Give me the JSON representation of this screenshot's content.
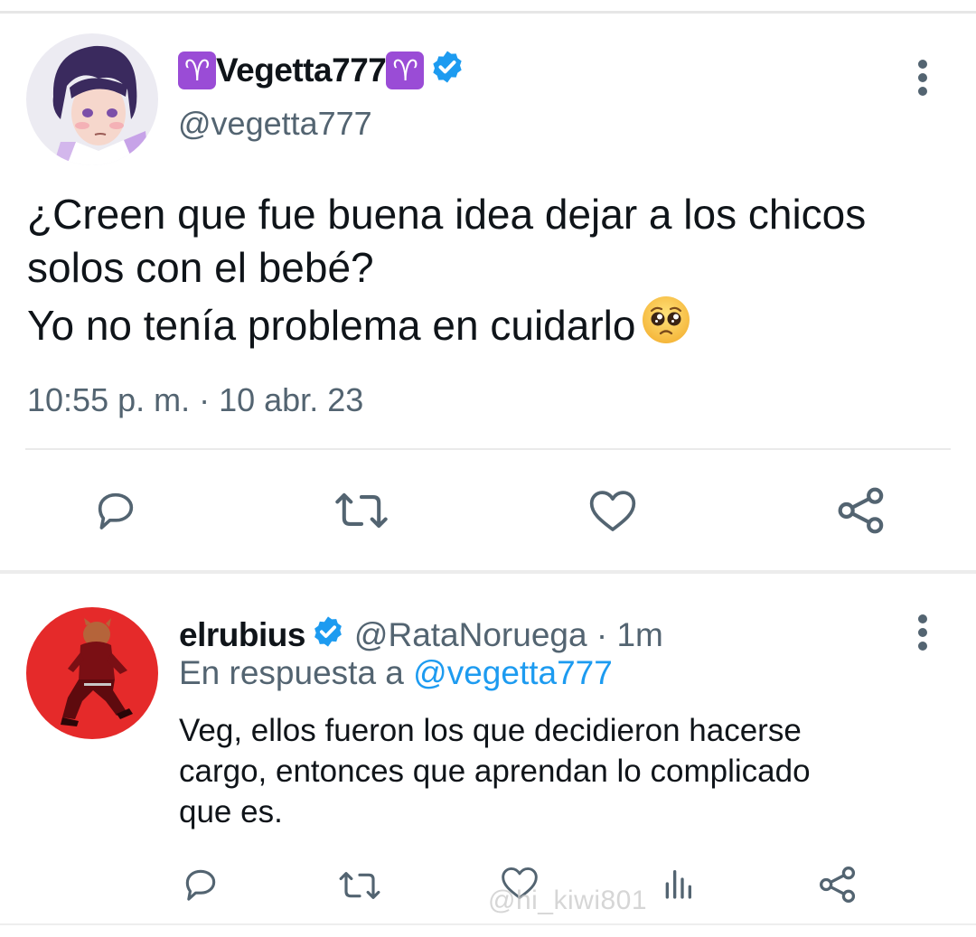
{
  "tweet": {
    "display_name_prefix_emoji": "♈",
    "display_name": "Vegetta777",
    "display_name_suffix_emoji": "♈",
    "handle": "@vegetta777",
    "text_lines": [
      "¿Creen que fue buena idea dejar a los chicos",
      "solos con el bebé?",
      "Yo no tenía problema en cuidarlo"
    ],
    "timestamp": "10:55 p. m. · 10 abr. 23",
    "verified": true,
    "icons": [
      "reply-icon",
      "retweet-icon",
      "like-icon",
      "share-icon",
      "more-icon",
      "pleading-face-emoji"
    ]
  },
  "reply": {
    "display_name": "elrubius",
    "handle_time": "@RataNoruega · 1m",
    "in_reply_prefix": "En respuesta a ",
    "in_reply_mention": "@vegetta777",
    "text_lines": [
      "Veg, ellos fueron los que decidieron hacerse",
      "cargo, entonces que aprendan lo complicado",
      "que es."
    ],
    "verified": true,
    "icons": [
      "reply-icon",
      "retweet-icon",
      "like-icon",
      "stats-icon",
      "share-icon",
      "more-icon"
    ]
  },
  "watermark": "@hi_kiwi801",
  "colors": {
    "text": "#0f1419",
    "secondary": "#536471",
    "accent": "#1d9bf0",
    "aries_badge": "#9a4cd6",
    "separator": "#eaeaea"
  }
}
